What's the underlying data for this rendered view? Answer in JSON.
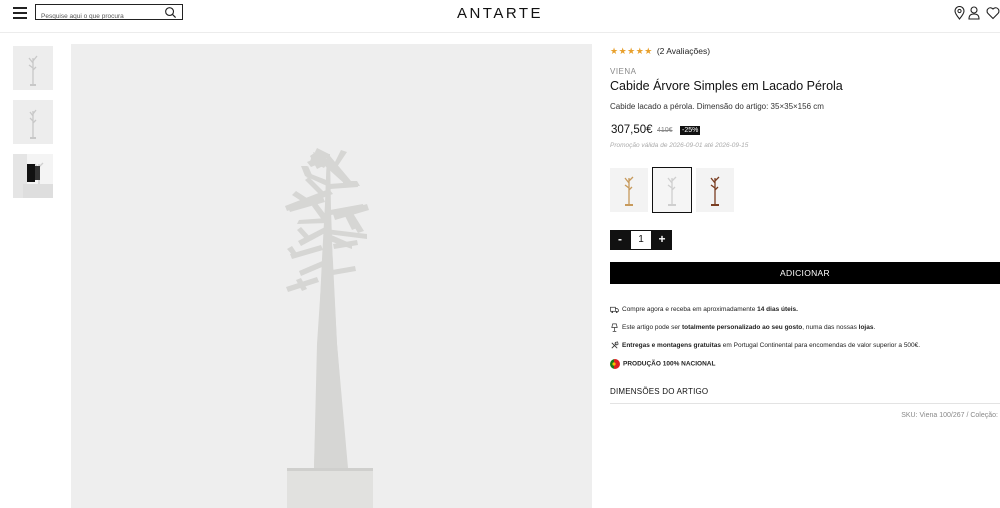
{
  "header": {
    "search_placeholder": "Pesquise aqui o que procura",
    "logo": "ANTARTE"
  },
  "product": {
    "rating_stars": "★★★★★",
    "rating_count": "(2 Avaliações)",
    "brand": "VIENA",
    "title": "Cabide Árvore Simples em Lacado Pérola",
    "description": "Cabide lacado a pérola. Dimensão do artigo: 35×35×156 cm",
    "price": "307,50€",
    "old_price": "410€",
    "discount": "-25%",
    "promo": "Promoção válida de 2026-09-01 até 2026-09-15",
    "quantity": "1",
    "qty_minus": "-",
    "qty_plus": "+",
    "add_button": "ADICIONAR"
  },
  "features": {
    "f1_a": "Compre agora e receba em aproximadamente ",
    "f1_b": "14 dias úteis.",
    "f2_a": "Este artigo pode ser ",
    "f2_b": "totalmente personalizado ao seu gosto",
    "f2_c": ", numa das nossas ",
    "f2_d": "lojas",
    "f2_e": ".",
    "f3_a": "Entregas e montagens gratuitas",
    "f3_b": " em Portugal Continental para encomendas de valor superior a 500€.",
    "f4": "PRODUÇÃO 100% NACIONAL"
  },
  "dimensions_label": "DIMENSÕES DO ARTIGO",
  "sku": "SKU: Viena 100/267 / Coleção:",
  "colors": {
    "accent": "#000000",
    "stars": "#e8a02c",
    "background": "#eeeeee"
  }
}
